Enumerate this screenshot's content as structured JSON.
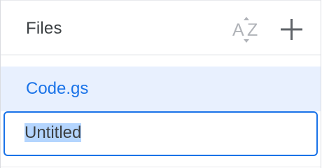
{
  "files_panel": {
    "title": "Files",
    "sort_icon": "sort-az-icon",
    "add_icon": "plus-icon",
    "items": [
      {
        "label": "Code.gs",
        "selected": true
      }
    ],
    "rename": {
      "value": "Untitled"
    }
  },
  "colors": {
    "accent": "#1a73e8",
    "selected_bg": "#e8f0fe",
    "text_selection": "#b4d5fe",
    "border": "#dadce0",
    "text": "#3c4043",
    "icon_muted": "#b0b3b8",
    "icon_dark": "#5f6368"
  }
}
